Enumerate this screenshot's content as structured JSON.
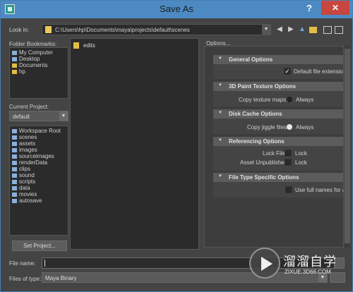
{
  "window": {
    "title": "Save As",
    "help_glyph": "?",
    "close_glyph": "✕"
  },
  "lookin": {
    "label": "Look in:",
    "path": "C:\\Users\\hp\\Documents\\maya\\projects\\default\\scenes"
  },
  "bookmarks": {
    "label": "Folder Bookmarks:",
    "items": [
      {
        "label": "My Computer",
        "icon": "computer-icon"
      },
      {
        "label": "Desktop",
        "icon": "desktop-icon"
      },
      {
        "label": "Documents",
        "icon": "folder-icon"
      },
      {
        "label": "hp",
        "icon": "folder-icon"
      }
    ]
  },
  "project": {
    "label": "Current Project:",
    "value": "default",
    "folders": [
      "Workspace Root",
      "scenes",
      "assets",
      "images",
      "sourceimages",
      "renderData",
      "clips",
      "sound",
      "scripts",
      "data",
      "movies",
      "autosave"
    ],
    "set_button": "Set Project..."
  },
  "files": [
    {
      "name": "edits",
      "icon": "folder-icon"
    }
  ],
  "options": {
    "label": "Options...",
    "general": {
      "title": "General Options",
      "default_ext_label": "Default file extensio",
      "default_ext_checked": true
    },
    "paint": {
      "title": "3D Paint Texture Options",
      "copy_label": "Copy texture maps:",
      "copy_value": "Always"
    },
    "cache": {
      "title": "Disk Cache Options",
      "jiggle_label": "Copy jiggle files:",
      "jiggle_value": "Always"
    },
    "referencing": {
      "title": "Referencing Options",
      "lock_file_label": "Lock File:",
      "lock_file_value": "Lock",
      "asset_label": "Asset Unpublished:",
      "asset_value": "Lock"
    },
    "filetype": {
      "title": "File Type Specific Options",
      "fullnames_label": "Use full names for a"
    }
  },
  "filename": {
    "label": "File name:",
    "value": ""
  },
  "filetype": {
    "label": "Files of type:",
    "value": "Maya Binary"
  },
  "watermark": {
    "text": "溜溜自学",
    "url": "ZIXUE.3D66.COM"
  }
}
